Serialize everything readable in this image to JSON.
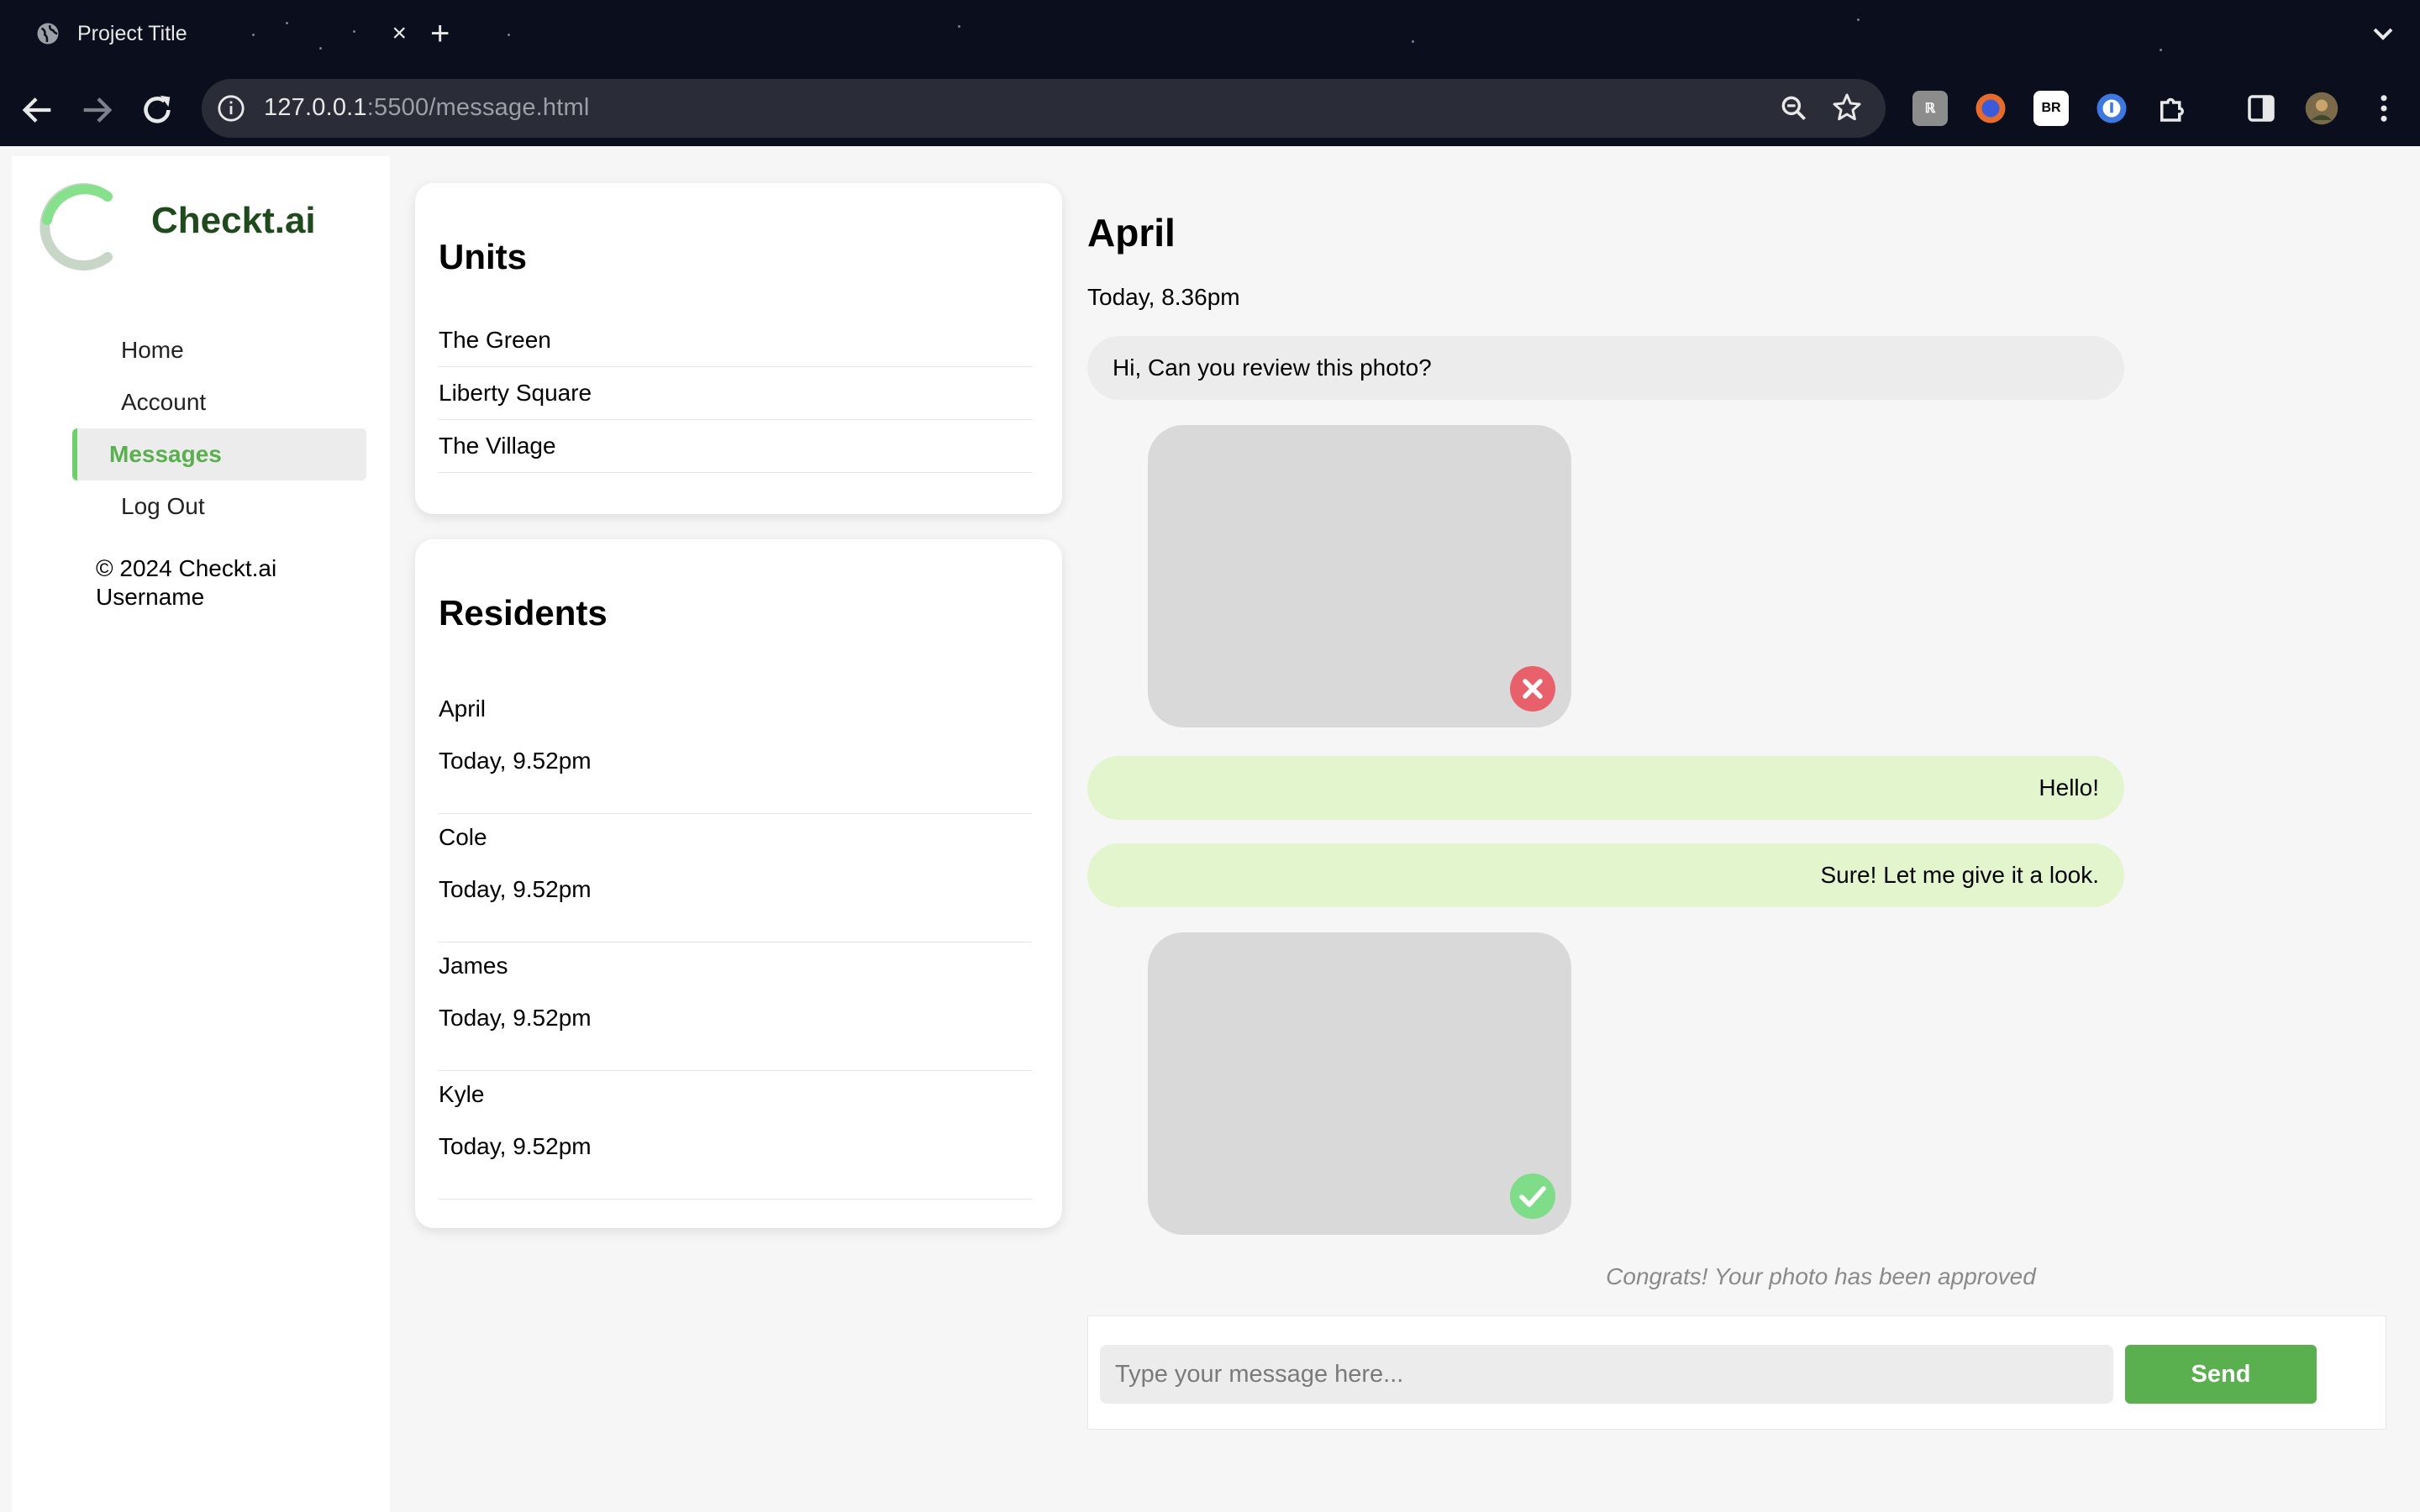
{
  "browser": {
    "tab_title": "Project Title",
    "tab_close": "×",
    "new_tab": "+",
    "url_host": "127.0.0.1",
    "url_path": ":5500/message.html",
    "ext_br": "BR"
  },
  "sidebar": {
    "brand": "Checkt.ai",
    "nav": [
      {
        "label": "Home"
      },
      {
        "label": "Account"
      },
      {
        "label": "Messages",
        "active": true
      },
      {
        "label": "Log Out"
      }
    ],
    "copyright": "© 2024 Checkt.ai",
    "username": "Username",
    "accent_color": "#6fcf6f"
  },
  "units": {
    "title": "Units",
    "items": [
      "The Green",
      "Liberty Square",
      "The Village"
    ]
  },
  "residents": {
    "title": "Residents",
    "items": [
      {
        "name": "April",
        "time": "Today, 9.52pm"
      },
      {
        "name": "Cole",
        "time": "Today, 9.52pm"
      },
      {
        "name": "James",
        "time": "Today, 9.52pm"
      },
      {
        "name": "Kyle",
        "time": "Today, 9.52pm"
      }
    ]
  },
  "chat": {
    "contact_name": "April",
    "timestamp": "Today, 8.36pm",
    "messages": [
      {
        "direction": "in",
        "text": "Hi, Can you review this photo?"
      },
      {
        "direction": "in",
        "type": "photo",
        "status": "rejected",
        "status_icon": "x-circle-icon"
      },
      {
        "direction": "out",
        "text": "Hello!"
      },
      {
        "direction": "out",
        "text": "Sure! Let me give it a look."
      },
      {
        "direction": "in",
        "type": "photo",
        "status": "approved",
        "status_icon": "check-circle-icon"
      }
    ],
    "approval_note": "Congrats! Your photo has been approved",
    "input_placeholder": "Type your message here...",
    "send_label": "Send",
    "colors": {
      "outgoing_bubble": "#e2f5cd",
      "incoming_bubble": "#ececec",
      "send_button": "#5aaf4e",
      "reject": "#e8606a",
      "approve": "#7fdc88"
    }
  }
}
